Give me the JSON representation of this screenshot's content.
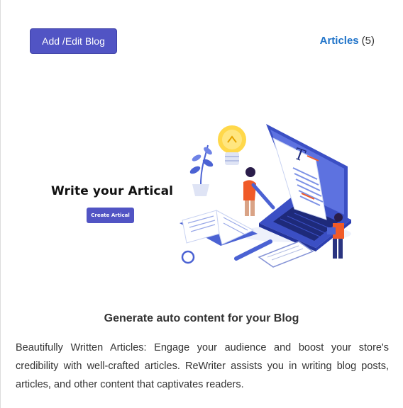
{
  "toolbar": {
    "add_edit_label": "Add /Edit Blog"
  },
  "articles": {
    "label": "Articles",
    "count": "(5)"
  },
  "hero": {
    "title": "Write your  Artical",
    "button_label": "Create Artical",
    "illustration_icon": "writing-laptop-illustration"
  },
  "content": {
    "heading": "Generate auto content for your Blog",
    "description": "Beautifully Written Articles: Engage your audience and boost your store's credibility with well-crafted articles. ReWriter assists you in writing blog posts, articles, and other content that captivates readers."
  },
  "colors": {
    "primary": "#5154c4",
    "link": "#1f73c9",
    "accent": "#f05a28",
    "text": "#333333"
  }
}
